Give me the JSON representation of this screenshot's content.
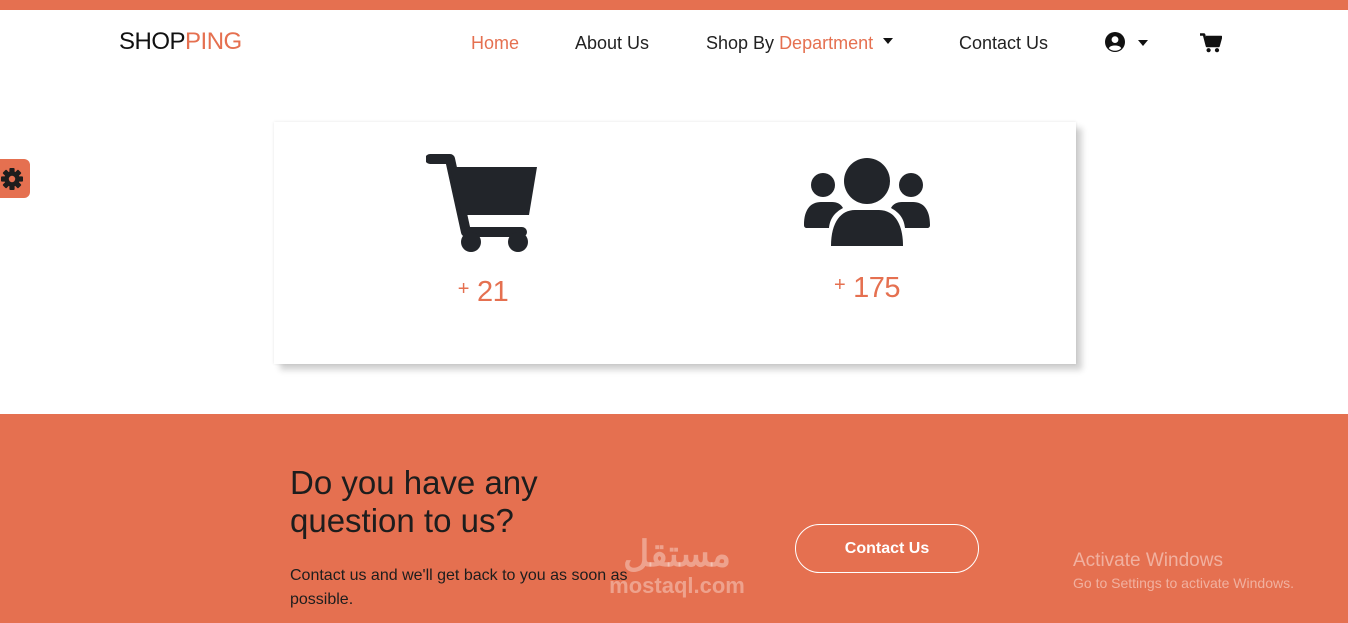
{
  "brand": {
    "part1": "SHOP",
    "part2": "PING"
  },
  "nav": {
    "home": "Home",
    "about": "About Us",
    "shop_by": "Shop By",
    "department": "Department",
    "contact": "Contact Us"
  },
  "icons": {
    "user": "user-circle-icon",
    "cart": "shopping-cart-icon",
    "settings": "gear-icon",
    "stat_cart": "shopping-cart-icon",
    "stat_users": "users-group-icon"
  },
  "stats": [
    {
      "prefix": "+",
      "value": "21"
    },
    {
      "prefix": "+",
      "value": "175"
    }
  ],
  "contact_section": {
    "heading": "Do you have any question to us?",
    "text": "Contact us and we'll get back to you as soon as possible.",
    "button_label": "Contact Us"
  },
  "watermark": {
    "arabic": "مستقل",
    "latin": "mostaql.com"
  },
  "windows_notice": {
    "title": "Activate Windows",
    "subtitle": "Go to Settings to activate Windows."
  },
  "colors": {
    "accent": "#e57050",
    "text_dark": "#212529",
    "white": "#ffffff"
  }
}
